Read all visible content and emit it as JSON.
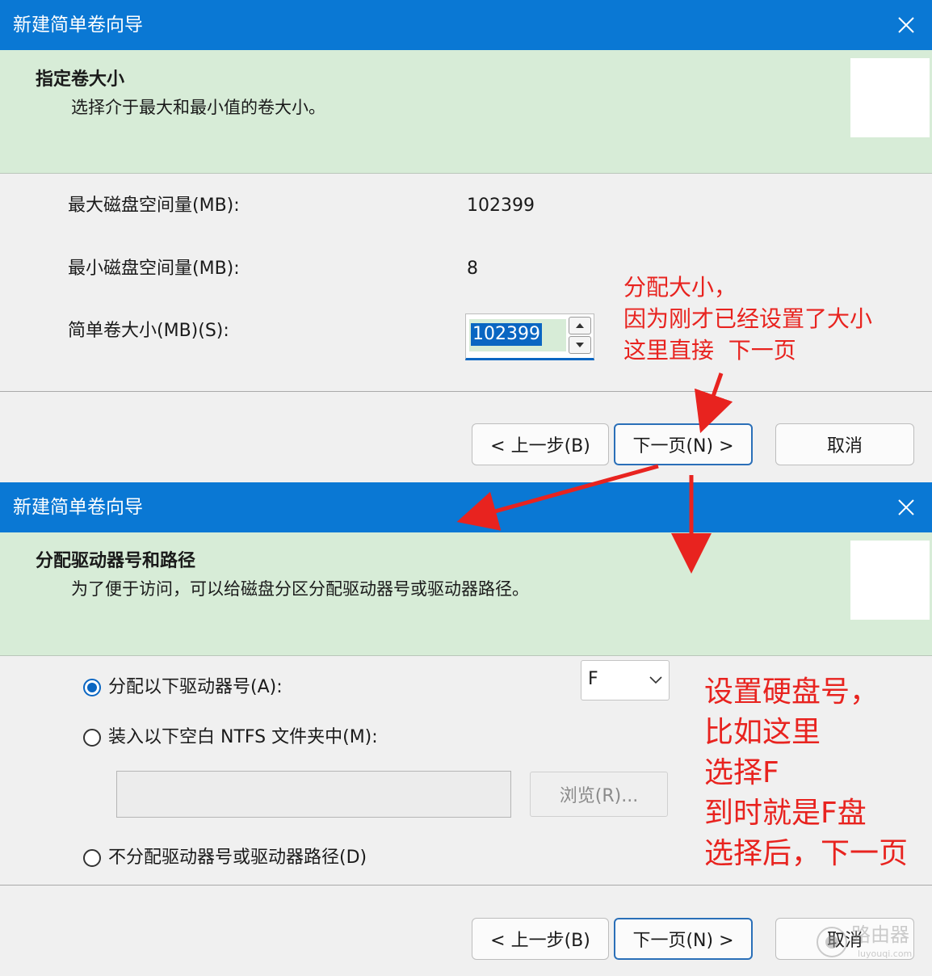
{
  "dialog1": {
    "title": "新建简单卷向导",
    "header_title": "指定卷大小",
    "header_subtitle": "选择介于最大和最小值的卷大小。",
    "max_label": "最大磁盘空间量(MB):",
    "max_value": "102399",
    "min_label": "最小磁盘空间量(MB):",
    "min_value": "8",
    "size_label": "简单卷大小(MB)(S):",
    "size_value": "102399",
    "back_label": "< 上一步(B)",
    "next_label": "下一页(N) >",
    "cancel_label": "取消"
  },
  "dialog2": {
    "title": "新建简单卷向导",
    "header_title": "分配驱动器号和路径",
    "header_subtitle": "为了便于访问，可以给磁盘分区分配驱动器号或驱动器路径。",
    "option_assign_label": "分配以下驱动器号(A):",
    "drive_letter": "F",
    "option_mount_label": "装入以下空白 NTFS 文件夹中(M):",
    "browse_label": "浏览(R)...",
    "option_none_label": "不分配驱动器号或驱动器路径(D)",
    "back_label": "< 上一步(B)",
    "next_label": "下一页(N) >",
    "cancel_label": "取消"
  },
  "annotations": {
    "size_note": "分配大小，\n因为刚才已经设置了大小\n这里直接  下一页",
    "drive_note": "设置硬盘号，\n比如这里\n选择F\n到时就是F盘\n选择后，下一页"
  },
  "watermark": {
    "text": "路由器",
    "url": "luyouqi.com"
  },
  "colors": {
    "titlebar": "#0a78d4",
    "header_bg": "#d7ecd7",
    "annotation": "#e8231f",
    "selection": "#0a66c2"
  }
}
